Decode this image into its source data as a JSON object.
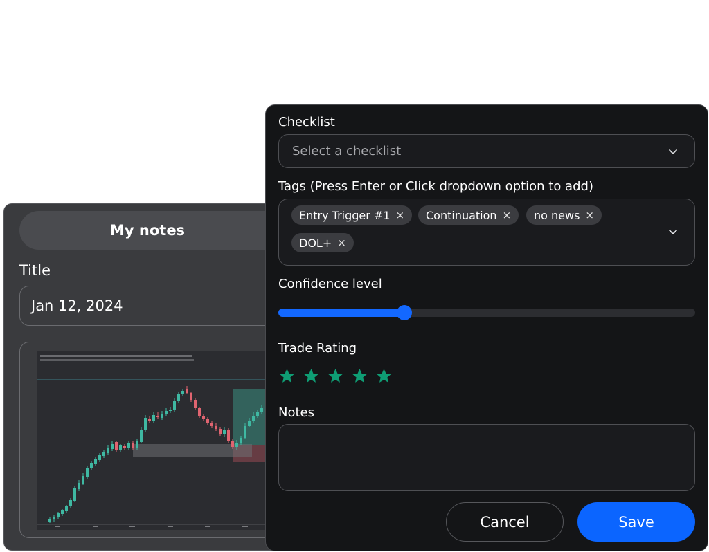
{
  "notes_card": {
    "header": "My notes",
    "title_label": "Title",
    "title_value": "Jan 12, 2024"
  },
  "form": {
    "checklist": {
      "label": "Checklist",
      "placeholder": "Select a checklist"
    },
    "tags": {
      "label": "Tags (Press Enter or Click dropdown option to add)",
      "items": [
        "Entry Trigger #1",
        "Continuation",
        "no news",
        "DOL+"
      ]
    },
    "confidence": {
      "label": "Confidence level",
      "value_fraction": 0.302
    },
    "rating": {
      "label": "Trade Rating",
      "value": 5,
      "max": 5
    },
    "notes": {
      "label": "Notes",
      "value": ""
    },
    "cancel_label": "Cancel",
    "save_label": "Save"
  },
  "colors": {
    "accent": "#1368ff",
    "star": "#0f9d74",
    "bull": "#3fb8a2",
    "bear": "#e06470"
  },
  "icons": {
    "remove_tag": "×",
    "dropdown": "chevron-down-icon",
    "rating": "star-icon"
  }
}
